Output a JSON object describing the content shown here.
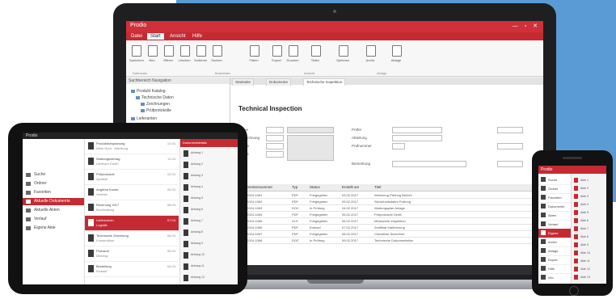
{
  "laptop": {
    "title": "Prodio",
    "window_controls": "— ▫ ✕",
    "menus": [
      "Datei",
      "Start",
      "Ansicht",
      "Hilfe"
    ],
    "ribbon_buttons": [
      "Speichern",
      "Neu",
      "Öffnen",
      "Löschen",
      "Sortieren",
      "Suchen",
      "Filtern",
      "Export",
      "Drucken",
      "Teilen",
      "Optionen",
      "Archiv",
      "Ablage"
    ],
    "ribbon_groups": [
      "Datensatz",
      "Bearbeiten",
      "Ansicht",
      "Ablage"
    ],
    "left_pane_header": "Sachbereich Navigation",
    "tree": [
      "Produkt Katalog",
      "Technische Daten",
      "Zeichnungen",
      "Prüfprotokolle",
      "Lieferanten"
    ],
    "tabs": [
      "Startseite",
      "Dokumente",
      "Technische Inspektion"
    ],
    "doc_title": "Technical Inspection",
    "form_labels": [
      "Name",
      "Bezeichnung",
      "Datum",
      "Status",
      "Prüfer",
      "Abteilung",
      "Prüfnummer",
      "Bemerkung"
    ],
    "grid_headers": [
      "Dokumentennummer",
      "Typ",
      "Status",
      "Erstellt am",
      "Titel"
    ],
    "grid_rows": [
      [
        "DOC-2024-1061",
        "PDF",
        "Freigegeben",
        "03.02.2017",
        "Werkzeug Prüfung Bericht"
      ],
      [
        "DOC-2024-1062",
        "PDF",
        "Freigegeben",
        "03.02.2017",
        "Sicherheitsdaten Prüfung"
      ],
      [
        "DOC-2024-1063",
        "DOC",
        "In Prüfung",
        "04.02.2017",
        "Wartungsplan Anlage"
      ],
      [
        "DOC-2024-1064",
        "PDF",
        "Freigegeben",
        "05.02.2017",
        "Prüfprotokoll Gerät"
      ],
      [
        "DOC-2024-1065",
        "XLS",
        "Freigegeben",
        "06.02.2017",
        "Messwerte Inspektion"
      ],
      [
        "DOC-2024-1066",
        "PDF",
        "Entwurf",
        "07.02.2017",
        "Zertifikat Kalibrierung"
      ],
      [
        "DOC-2024-1067",
        "PDF",
        "Freigegeben",
        "08.02.2017",
        "Checkliste Sicherheit"
      ],
      [
        "DOC-2024-1068",
        "DOC",
        "In Prüfung",
        "09.02.2017",
        "Technische Dokumentation"
      ]
    ]
  },
  "tablet": {
    "top_label": "Prodio",
    "nav": [
      "Suche",
      "Ordner",
      "Favoriten",
      "Aktuelle Dokumente",
      "Aktuelle Akten",
      "Verlauf",
      "Eigene Akte"
    ],
    "list": [
      {
        "t": "Produktionsplanung",
        "s": "Werk Nord · Abteilung",
        "d": "12.03."
      },
      {
        "t": "Wartungsvertrag",
        "s": "Lieferant Gmbh",
        "d": "11.03."
      },
      {
        "t": "Prüfprotokoll",
        "s": "Qualität",
        "d": "10.03."
      },
      {
        "t": "Angebot Kunde",
        "s": "Vertrieb",
        "d": "09.03."
      },
      {
        "t": "Rechnung 2017",
        "s": "Buchhaltung",
        "d": "08.03."
      },
      {
        "t": "Lieferschein",
        "s": "Logistik",
        "d": "07.03."
      },
      {
        "t": "Technische Zeichnung",
        "s": "Konstruktion",
        "d": "06.03."
      },
      {
        "t": "Protokoll",
        "s": "Meeting",
        "d": "05.03."
      },
      {
        "t": "Bestellung",
        "s": "Einkauf",
        "d": "04.03."
      }
    ],
    "detail_header": "Dokumentdetails",
    "detail_items": [
      "Anhang 1",
      "Anhang 2",
      "Anhang 3",
      "Anhang 4",
      "Anhang 5",
      "Anhang 6",
      "Anhang 7",
      "Anhang 8",
      "Anhang 9",
      "Anhang 10",
      "Anhang 11",
      "Anhang 12"
    ]
  },
  "phone": {
    "top_label": "Prodio",
    "items": [
      "Suche",
      "Ordner",
      "Favoriten",
      "Dokumente",
      "Akten",
      "Verlauf",
      "Eigene",
      "Archiv",
      "Ablage",
      "Export",
      "Hilfe",
      "Info"
    ],
    "detail": [
      "Akte 1",
      "Akte 2",
      "Akte 3",
      "Akte 4",
      "Akte 5",
      "Akte 6",
      "Akte 7",
      "Akte 8",
      "Akte 9",
      "Akte 10",
      "Akte 11",
      "Akte 12",
      "Akte 13"
    ]
  },
  "colors": {
    "brand_red": "#c52a33",
    "background_blue": "#5b9bd5",
    "device_black": "#121212"
  }
}
